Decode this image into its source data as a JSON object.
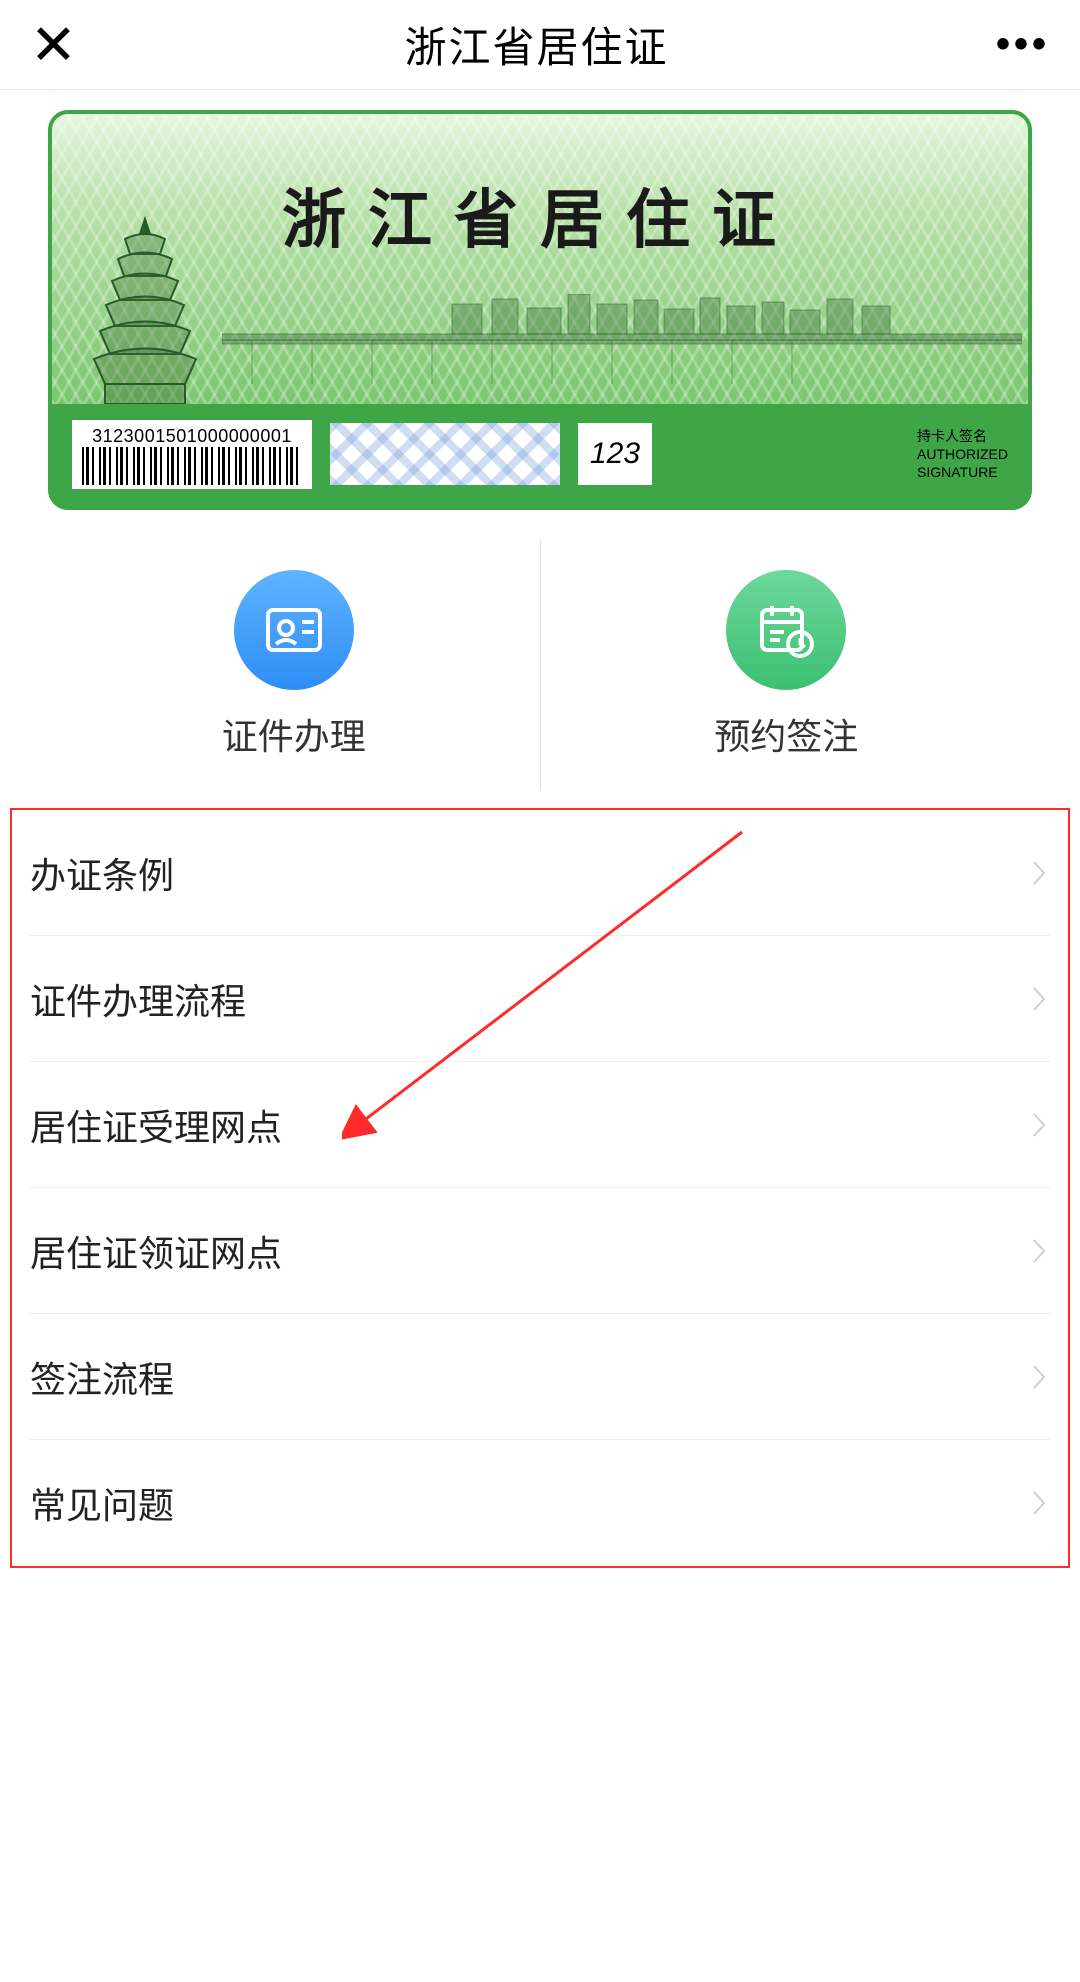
{
  "header": {
    "title": "浙江省居住证"
  },
  "card": {
    "title": "浙江省居住证",
    "barcodeNumber": "3123001501000000001",
    "cvv": "123",
    "sigLine1": "持卡人签名",
    "sigLine2": "AUTHORIZED",
    "sigLine3": "SIGNATURE"
  },
  "actions": [
    {
      "label": "证件办理",
      "icon": "id-card-icon"
    },
    {
      "label": "预约签注",
      "icon": "calendar-clock-icon"
    }
  ],
  "menu": [
    {
      "label": "办证条例"
    },
    {
      "label": "证件办理流程"
    },
    {
      "label": "居住证受理网点"
    },
    {
      "label": "居住证领证网点"
    },
    {
      "label": "签注流程"
    },
    {
      "label": "常见问题"
    }
  ]
}
